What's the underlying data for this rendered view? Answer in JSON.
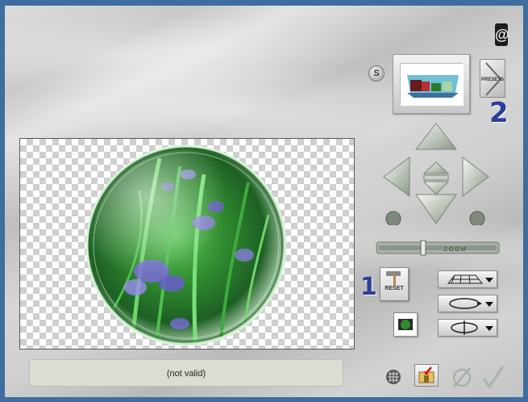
{
  "status": {
    "text": "(not valid)"
  },
  "presets": {
    "label": "PRESETS"
  },
  "reset": {
    "label": "RESET"
  },
  "annotations": {
    "one": "1",
    "two": "2"
  },
  "zoom_slider": {
    "label": "Z O O M"
  },
  "corner_logo": {
    "glyph": "@"
  },
  "s_button": {
    "label": "S"
  },
  "icons": {
    "sphere": "glass-sphere-iris-preview",
    "thumb": "preset-thumbnail-icon",
    "nav": [
      "arrow-up-icon",
      "arrow-down-icon",
      "arrow-left-icon",
      "arrow-right-icon",
      "center-icon",
      "rotate-left-icon",
      "rotate-right-icon"
    ],
    "dropdowns": [
      "grid-plane-icon",
      "rotate-loop-icon",
      "flip-axis-icon"
    ],
    "bottom": [
      "grid-toggle-icon",
      "load-icon",
      "cancel-icon",
      "ok-checkmark-icon"
    ]
  },
  "colors": {
    "frame": "#3f6d9e",
    "annotation": "#2a3f98",
    "sphere_green": "#2f8a2f",
    "iris_purple": "#7b6bd8"
  }
}
